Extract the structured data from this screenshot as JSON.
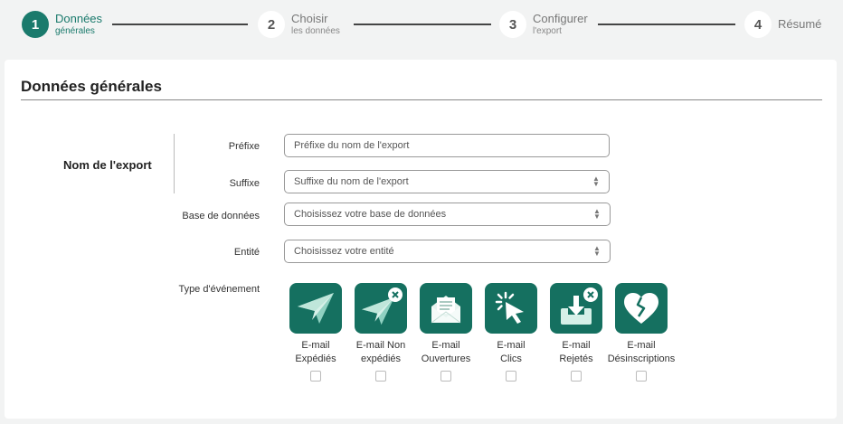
{
  "stepper": {
    "steps": [
      {
        "num": "1",
        "line1": "Données",
        "line2": "générales"
      },
      {
        "num": "2",
        "line1": "Choisir",
        "line2": "les données"
      },
      {
        "num": "3",
        "line1": "Configurer",
        "line2": "l'export"
      },
      {
        "num": "4",
        "line1": "Résumé",
        "line2": ""
      }
    ],
    "active_step": 1
  },
  "section": {
    "title": "Données générales",
    "group_label": "Nom de l'export"
  },
  "fields": {
    "prefixe": {
      "label": "Préfixe",
      "placeholder": "Préfixe du nom de l'export"
    },
    "suffixe": {
      "label": "Suffixe",
      "placeholder": "Suffixe du nom de l'export"
    },
    "base": {
      "label": "Base de données",
      "placeholder": "Choisissez votre base de données"
    },
    "entite": {
      "label": "Entité",
      "placeholder": "Choisissez votre entité"
    }
  },
  "event_type": {
    "label": "Type d'événement",
    "items": [
      {
        "line1": "E-mail",
        "line2": "Expédiés",
        "icon": "paper-plane-icon"
      },
      {
        "line1": "E-mail Non",
        "line2": "expédiés",
        "icon": "paper-plane-cross-icon"
      },
      {
        "line1": "E-mail",
        "line2": "Ouvertures",
        "icon": "open-envelope-icon"
      },
      {
        "line1": "E-mail",
        "line2": "Clics",
        "icon": "cursor-click-icon"
      },
      {
        "line1": "E-mail",
        "line2": "Rejetés",
        "icon": "inbox-reject-icon"
      },
      {
        "line1": "E-mail",
        "line2": "Désinscriptions",
        "icon": "broken-heart-icon"
      }
    ]
  },
  "colors": {
    "accent": "#1a7a6c",
    "tile": "#157060"
  }
}
